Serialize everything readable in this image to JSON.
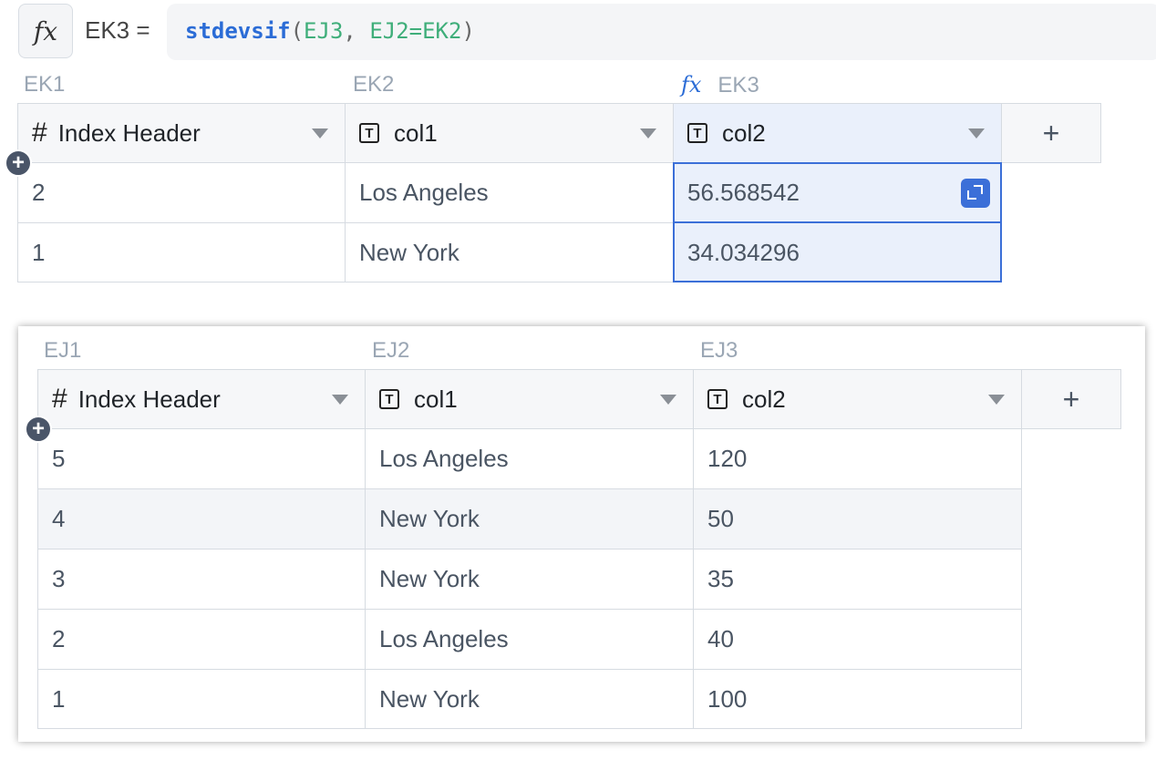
{
  "formula_bar": {
    "fx_glyph": "fx",
    "cell_ref": "EK3 =",
    "fn": "stdevsif",
    "open": "(",
    "arg1": "EJ3",
    "comma": ", ",
    "arg2": "EJ2=EK2",
    "close": ")"
  },
  "table_top": {
    "col_letters": [
      "EK1",
      "EK2",
      "EK3"
    ],
    "formula_col_glyph": "fx",
    "headers": [
      "Index Header",
      "col1",
      "col2"
    ],
    "header_icons": [
      "#",
      "T",
      "T"
    ],
    "add_column": "+",
    "rows": [
      [
        "2",
        "Los Angeles",
        "56.568542"
      ],
      [
        "1",
        "New York",
        "34.034296"
      ]
    ]
  },
  "table_bottom": {
    "col_letters": [
      "EJ1",
      "EJ2",
      "EJ3"
    ],
    "headers": [
      "Index Header",
      "col1",
      "col2"
    ],
    "header_icons": [
      "#",
      "T",
      "T"
    ],
    "add_column": "+",
    "rows": [
      [
        "5",
        "Los Angeles",
        "120"
      ],
      [
        "4",
        "New York",
        "50"
      ],
      [
        "3",
        "New York",
        "35"
      ],
      [
        "2",
        "Los Angeles",
        "40"
      ],
      [
        "1",
        "New York",
        "100"
      ]
    ]
  },
  "add_row_symbol": "+",
  "colors": {
    "selection": "#3b6fd8",
    "formula_fn": "#2b6cd6",
    "formula_ref": "#3fae7a"
  }
}
